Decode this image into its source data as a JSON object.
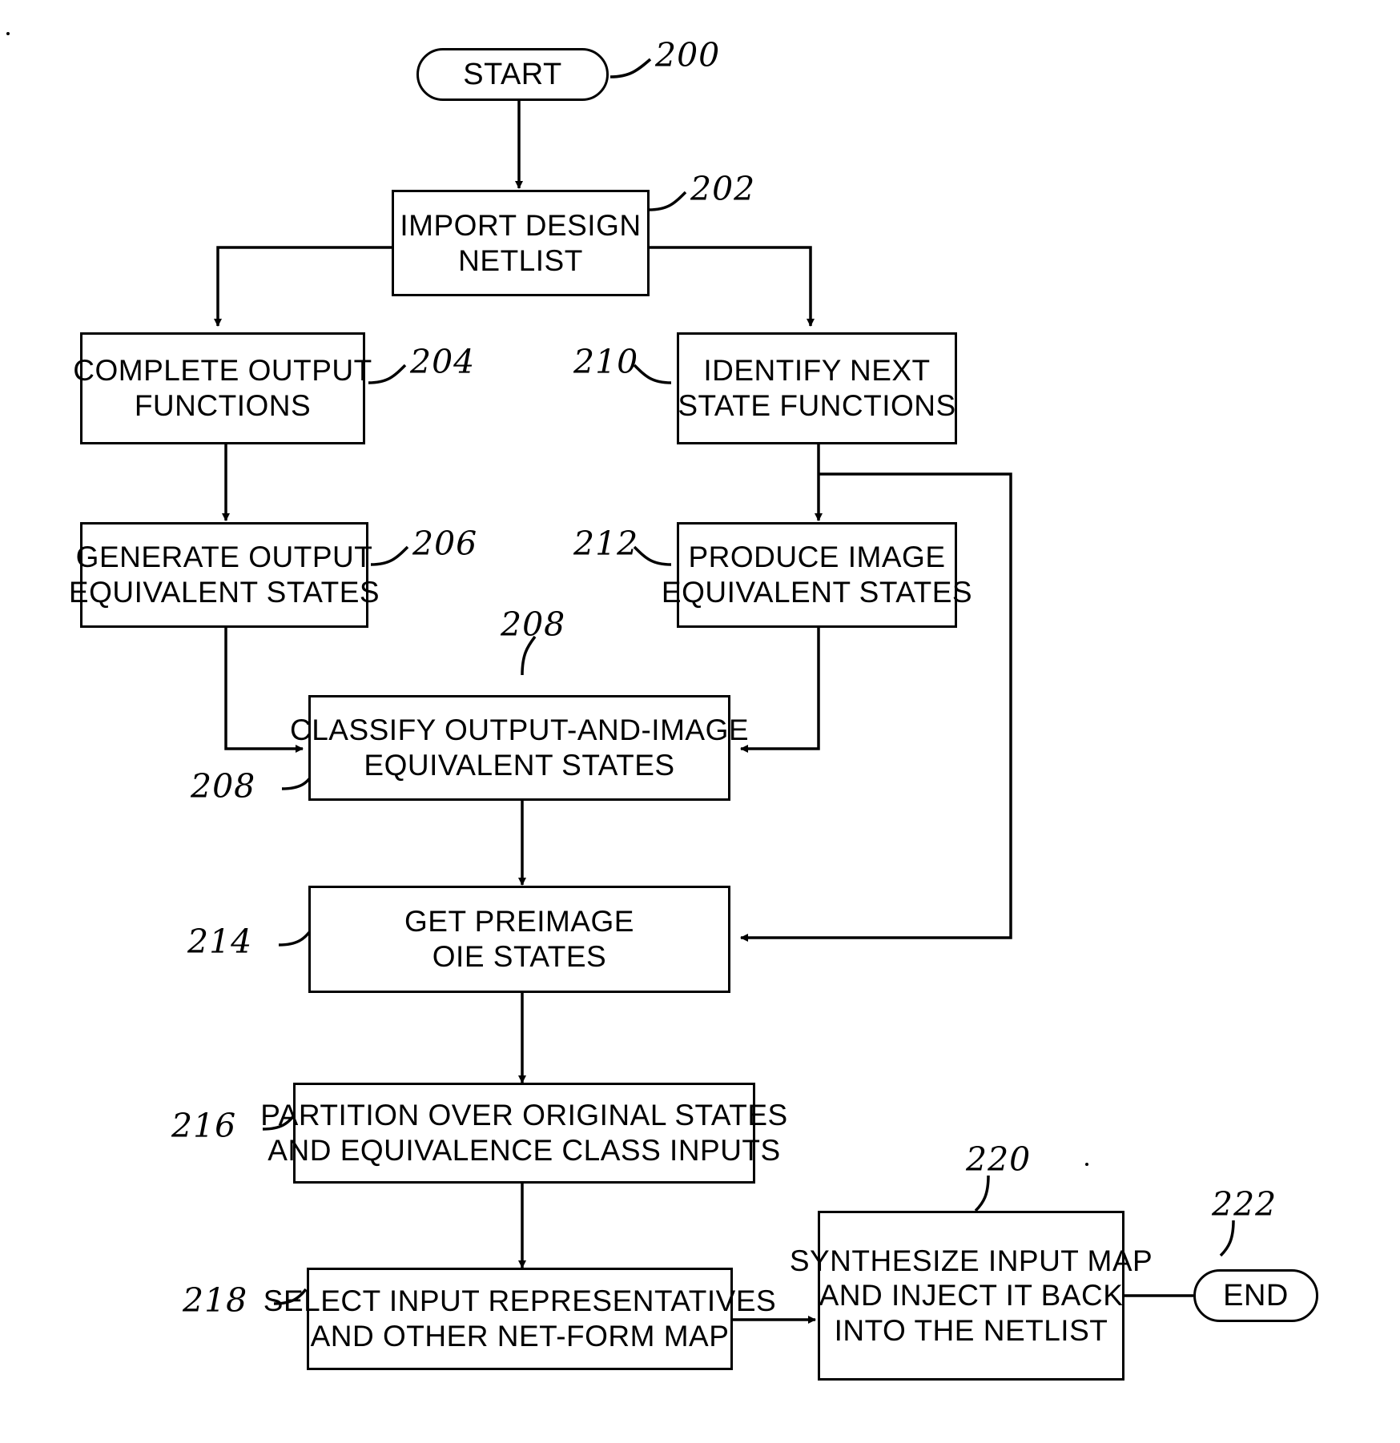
{
  "figure": {
    "type": "flowchart",
    "title": "",
    "nodes": [
      {
        "id": "200",
        "shape": "terminator",
        "lines": [
          "START"
        ],
        "ref": "200"
      },
      {
        "id": "202",
        "shape": "process",
        "lines": [
          "IMPORT DESIGN",
          "NETLIST"
        ],
        "ref": "202"
      },
      {
        "id": "204",
        "shape": "process",
        "lines": [
          "COMPLETE OUTPUT",
          "FUNCTIONS"
        ],
        "ref": "204"
      },
      {
        "id": "210",
        "shape": "process",
        "lines": [
          "IDENTIFY NEXT",
          "STATE FUNCTIONS"
        ],
        "ref": "210"
      },
      {
        "id": "206",
        "shape": "process",
        "lines": [
          "GENERATE OUTPUT",
          "EQUIVALENT STATES"
        ],
        "ref": "206"
      },
      {
        "id": "212",
        "shape": "process",
        "lines": [
          "PRODUCE IMAGE",
          "EQUIVALENT STATES"
        ],
        "ref": "212"
      },
      {
        "id": "208",
        "shape": "process",
        "lines": [
          "CLASSIFY OUTPUT-AND-IMAGE",
          "EQUIVALENT STATES"
        ],
        "ref": "208",
        "ref2": "208"
      },
      {
        "id": "214",
        "shape": "process",
        "lines": [
          "GET PREIMAGE",
          "OIE STATES"
        ],
        "ref": "214"
      },
      {
        "id": "216",
        "shape": "process",
        "lines": [
          "PARTITION OVER ORIGINAL STATES",
          "AND EQUIVALENCE CLASS INPUTS"
        ],
        "ref": "216"
      },
      {
        "id": "218",
        "shape": "process",
        "lines": [
          "SELECT INPUT REPRESENTATIVES",
          "AND OTHER NET-FORM MAP"
        ],
        "ref": "218"
      },
      {
        "id": "220",
        "shape": "process",
        "lines": [
          "SYNTHESIZE INPUT MAP",
          "AND INJECT IT BACK",
          "INTO THE NETLIST"
        ],
        "ref": "220"
      },
      {
        "id": "222",
        "shape": "terminator",
        "lines": [
          "END"
        ],
        "ref": "222"
      }
    ],
    "ref_labels": [
      {
        "text": "200"
      },
      {
        "text": "202"
      },
      {
        "text": "204"
      },
      {
        "text": "210"
      },
      {
        "text": "206"
      },
      {
        "text": "212"
      },
      {
        "text": "208"
      },
      {
        "text": "208"
      },
      {
        "text": "214"
      },
      {
        "text": "216"
      },
      {
        "text": "218"
      },
      {
        "text": "220"
      },
      {
        "text": "222"
      }
    ],
    "edges": [
      {
        "from": "200",
        "to": "202"
      },
      {
        "from": "202",
        "to": "204"
      },
      {
        "from": "202",
        "to": "210"
      },
      {
        "from": "204",
        "to": "206"
      },
      {
        "from": "210",
        "to": "212"
      },
      {
        "from": "210",
        "to": "214"
      },
      {
        "from": "206",
        "to": "208"
      },
      {
        "from": "212",
        "to": "208"
      },
      {
        "from": "208",
        "to": "214"
      },
      {
        "from": "214",
        "to": "216"
      },
      {
        "from": "216",
        "to": "218"
      },
      {
        "from": "218",
        "to": "220"
      },
      {
        "from": "220",
        "to": "222"
      }
    ],
    "colors": {
      "stroke": "#000000",
      "fill": "#ffffff"
    }
  }
}
